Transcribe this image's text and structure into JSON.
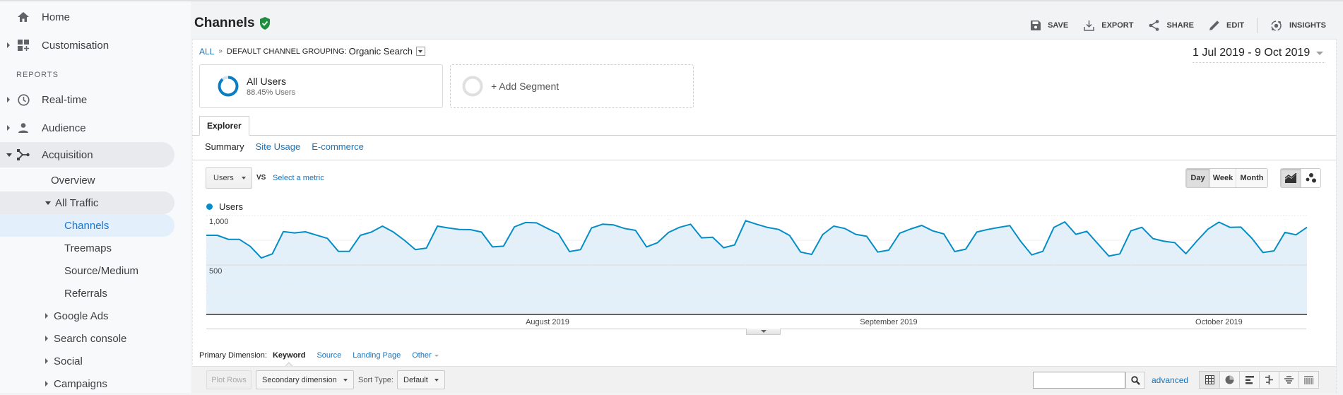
{
  "sidebar": {
    "items": [
      {
        "label": "Home",
        "icon": "home-icon"
      },
      {
        "label": "Customisation",
        "icon": "dashboard-plus-icon"
      },
      {
        "label": "Real-time",
        "icon": "clock-icon"
      },
      {
        "label": "Audience",
        "icon": "person-icon"
      },
      {
        "label": "Acquisition",
        "icon": "acquisition-icon"
      }
    ],
    "section_label": "REPORTS",
    "acquisition_children": [
      {
        "label": "Overview"
      },
      {
        "label": "All Traffic"
      },
      {
        "label": "Channels"
      },
      {
        "label": "Treemaps"
      },
      {
        "label": "Source/Medium"
      },
      {
        "label": "Referrals"
      },
      {
        "label": "Google Ads"
      },
      {
        "label": "Search console"
      },
      {
        "label": "Social"
      },
      {
        "label": "Campaigns"
      }
    ]
  },
  "header": {
    "title": "Channels",
    "actions": [
      {
        "label": "SAVE",
        "icon": "save-icon"
      },
      {
        "label": "EXPORT",
        "icon": "export-icon"
      },
      {
        "label": "SHARE",
        "icon": "share-icon"
      },
      {
        "label": "EDIT",
        "icon": "edit-icon"
      },
      {
        "label": "INSIGHTS",
        "icon": "insights-icon"
      }
    ]
  },
  "breadcrumb": {
    "root": "ALL",
    "separator": "»",
    "dimension": "DEFAULT CHANNEL GROUPING:",
    "value": "Organic Search"
  },
  "date_range": "1 Jul 2019 - 9 Oct 2019",
  "segments": {
    "active": {
      "title": "All Users",
      "subtitle": "88.45% Users",
      "percent": 88.45
    },
    "add_label": "+ Add Segment"
  },
  "explorer": {
    "tab": "Explorer",
    "subtabs": [
      "Summary",
      "Site Usage",
      "E-commerce"
    ],
    "metric": "Users",
    "vs": "VS",
    "select_metric": "Select a metric",
    "granularity": [
      "Day",
      "Week",
      "Month"
    ],
    "selected_granularity": "Day"
  },
  "colors": {
    "accent": "#058dc7",
    "link": "#1a73b8",
    "area_fill": "#e3f0f9"
  },
  "chart_data": {
    "type": "area",
    "title": "",
    "legend": [
      "Users"
    ],
    "legend_placement": "top-left",
    "xlabel": "",
    "ylabel": "",
    "ylim": [
      0,
      1000
    ],
    "yticks": [
      500,
      1000
    ],
    "ytick_labels": [
      "500",
      "1,000"
    ],
    "x_start": "2019-07-01",
    "x_end": "2019-10-09",
    "x_tick_labels": [
      {
        "label": "August 2019",
        "index": 31
      },
      {
        "label": "September 2019",
        "index": 62
      },
      {
        "label": "October 2019",
        "index": 92
      }
    ],
    "series": [
      {
        "name": "Users",
        "values": [
          800,
          800,
          759,
          759,
          688,
          571,
          612,
          838,
          824,
          836,
          802,
          769,
          638,
          638,
          800,
          833,
          893,
          833,
          750,
          655,
          671,
          893,
          874,
          859,
          857,
          833,
          683,
          690,
          886,
          929,
          926,
          869,
          814,
          636,
          655,
          874,
          912,
          905,
          869,
          850,
          683,
          726,
          829,
          881,
          912,
          774,
          781,
          674,
          702,
          948,
          912,
          879,
          859,
          798,
          631,
          607,
          807,
          893,
          869,
          810,
          790,
          631,
          650,
          821,
          864,
          900,
          845,
          814,
          636,
          660,
          833,
          859,
          879,
          898,
          738,
          602,
          638,
          879,
          936,
          810,
          840,
          714,
          590,
          612,
          845,
          881,
          767,
          740,
          726,
          614,
          743,
          862,
          933,
          881,
          883,
          769,
          626,
          643,
          829,
          805,
          881
        ]
      }
    ]
  },
  "primary_dimension": {
    "label": "Primary Dimension:",
    "options": [
      "Keyword",
      "Source",
      "Landing Page",
      "Other"
    ],
    "selected": "Keyword"
  },
  "table_toolbar": {
    "plot_rows": "Plot Rows",
    "secondary_dimension": "Secondary dimension",
    "sort_type_label": "Sort Type:",
    "sort_type_value": "Default",
    "search_value": "",
    "advanced": "advanced"
  }
}
